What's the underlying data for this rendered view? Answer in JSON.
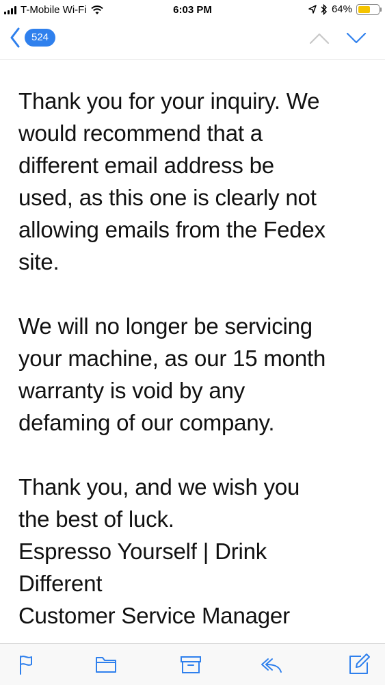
{
  "status_bar": {
    "carrier": "T-Mobile Wi-Fi",
    "time": "6:03 PM",
    "battery_percent": "64%",
    "battery_level": 0.64
  },
  "nav": {
    "unread_count": "524"
  },
  "message": {
    "paragraph1": [
      "Thank you for your inquiry. We",
      "would recommend that a",
      "different email address be",
      "used, as this one is clearly not",
      "allowing emails from the Fedex",
      "site."
    ],
    "paragraph2": [
      "We will no longer be servicing",
      "your machine, as our 15 month",
      "warranty is void by any",
      "defaming of our company."
    ],
    "paragraph3": [
      "Thank you, and we wish you",
      "the best of luck.",
      "Espresso Yourself | Drink",
      "Different",
      "Customer Service Manager"
    ]
  },
  "toolbar": {
    "icons": [
      "flag-icon",
      "folder-icon",
      "archive-icon",
      "reply-icon",
      "compose-icon"
    ]
  },
  "colors": {
    "accent": "#2f80ed",
    "battery": "#f5c400"
  }
}
